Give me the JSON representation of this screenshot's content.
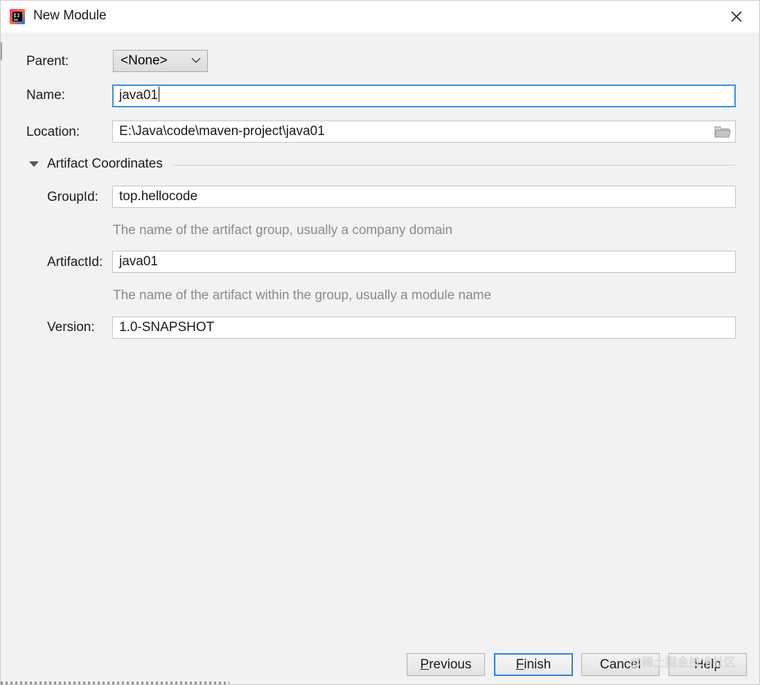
{
  "window": {
    "title": "New Module",
    "icon": "intellij-idea-icon",
    "close_icon": "close-icon"
  },
  "form": {
    "parent": {
      "label": "Parent:",
      "value": "<None>"
    },
    "name": {
      "label": "Name:",
      "value": "java01"
    },
    "location": {
      "label": "Location:",
      "value": "E:\\Java\\code\\maven-project\\java01",
      "icon": "folder-icon"
    }
  },
  "artifact": {
    "section_title": "Artifact Coordinates",
    "group_id": {
      "label": "GroupId:",
      "value": "top.hellocode",
      "hint": "The name of the artifact group, usually a company domain"
    },
    "artifact_id": {
      "label": "ArtifactId:",
      "value": "java01",
      "hint": "The name of the artifact within the group, usually a module name"
    },
    "version": {
      "label": "Version:",
      "value": "1.0-SNAPSHOT"
    }
  },
  "buttons": {
    "previous": {
      "mnemonic": "P",
      "rest": "revious"
    },
    "finish": {
      "mnemonic": "F",
      "rest": "inish"
    },
    "cancel": "Cancel",
    "help": "Help"
  },
  "watermark": "@稀土掘金技术社区",
  "colors": {
    "focus_border": "#3b8fd6",
    "background": "#f2f2f2",
    "hint_text": "#8a8a8a"
  }
}
